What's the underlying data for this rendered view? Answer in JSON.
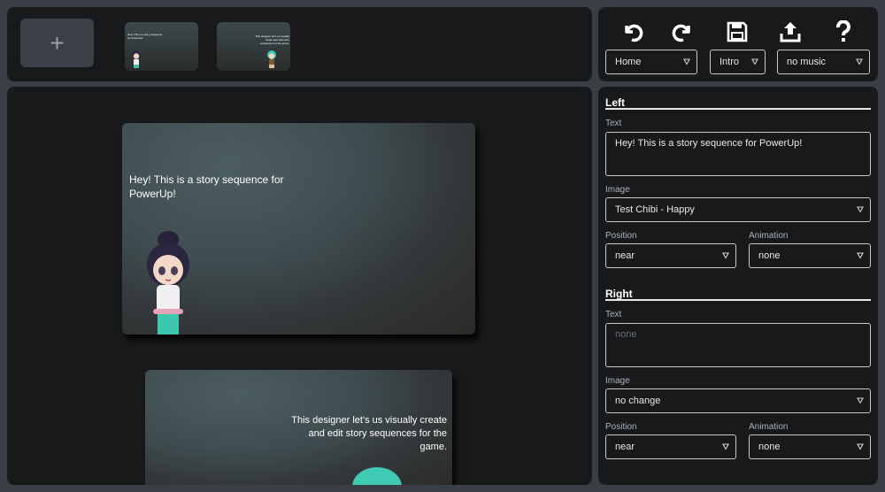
{
  "thumbnails": {
    "add_label": "+",
    "items": [
      {
        "mini_text": "Hey! This is a story sequence for PowerUp!"
      },
      {
        "mini_text": "This designer let's us visually create and edit story sequences for the game."
      }
    ]
  },
  "toolbar": {
    "icons": [
      "undo-icon",
      "redo-icon",
      "save-icon",
      "upload-icon",
      "help-icon"
    ],
    "scene_select": "Home",
    "sequence_select": "Intro",
    "music_select": "no music"
  },
  "stage": {
    "slides": [
      {
        "text": "Hey! This is a story sequence for PowerUp!"
      },
      {
        "text": "This designer let's us visually create and edit story sequences for the game."
      }
    ]
  },
  "props": {
    "left": {
      "title": "Left",
      "text_label": "Text",
      "text_value": "Hey! This is a story sequence for PowerUp!",
      "image_label": "Image",
      "image_value": "Test Chibi - Happy",
      "position_label": "Position",
      "position_value": "near",
      "animation_label": "Animation",
      "animation_value": "none"
    },
    "right": {
      "title": "Right",
      "text_label": "Text",
      "text_placeholder": "none",
      "image_label": "Image",
      "image_value": "no change",
      "position_label": "Position",
      "position_value": "near",
      "animation_label": "Animation",
      "animation_value": "none"
    }
  }
}
